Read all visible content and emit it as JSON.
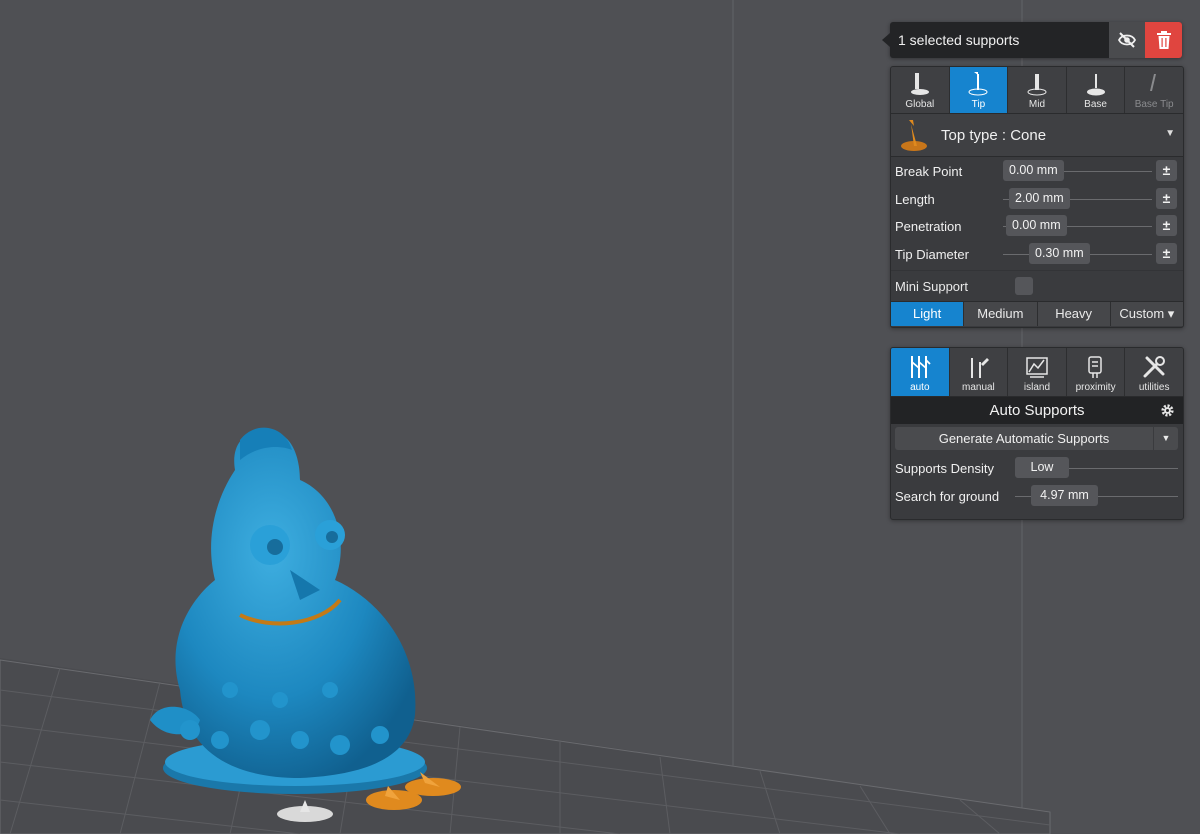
{
  "selection_bar": {
    "text": "1 selected supports",
    "hide_icon": "eye-slash-icon",
    "delete_icon": "trash-icon"
  },
  "support_tabs": [
    {
      "label": "Global",
      "icon": "support-global-icon",
      "active": false,
      "disabled": false
    },
    {
      "label": "Tip",
      "icon": "support-tip-icon",
      "active": true,
      "disabled": false
    },
    {
      "label": "Mid",
      "icon": "support-mid-icon",
      "active": false,
      "disabled": false
    },
    {
      "label": "Base",
      "icon": "support-base-icon",
      "active": false,
      "disabled": false
    },
    {
      "label": "Base Tip",
      "icon": "support-base-tip-icon",
      "active": false,
      "disabled": true
    }
  ],
  "top_type": {
    "label": "Top type : Cone",
    "icon": "cone-support-icon"
  },
  "params": [
    {
      "label": "Break Point",
      "value": "0.00 mm"
    },
    {
      "label": "Length",
      "value": "2.00 mm"
    },
    {
      "label": "Penetration",
      "value": "0.00 mm"
    },
    {
      "label": "Tip Diameter",
      "value": "0.30 mm"
    }
  ],
  "pm_label": "±",
  "mini_support": {
    "label": "Mini Support",
    "checked": false
  },
  "density_presets": [
    {
      "label": "Light",
      "active": true
    },
    {
      "label": "Medium",
      "active": false
    },
    {
      "label": "Heavy",
      "active": false
    },
    {
      "label": "Custom ▾",
      "active": false
    }
  ],
  "mode_tabs": [
    {
      "label": "auto",
      "icon": "auto-supports-icon",
      "active": true
    },
    {
      "label": "manual",
      "icon": "manual-supports-icon",
      "active": false
    },
    {
      "label": "island",
      "icon": "island-icon",
      "active": false
    },
    {
      "label": "proximity",
      "icon": "proximity-icon",
      "active": false
    },
    {
      "label": "utilities",
      "icon": "tools-icon",
      "active": false
    }
  ],
  "auto_supports": {
    "title": "Auto Supports",
    "generate_label": "Generate Automatic Supports",
    "density_label": "Supports Density",
    "density_value": "Low",
    "search_label": "Search for ground",
    "search_value": "4.97 mm"
  },
  "colors": {
    "accent": "#1684cf",
    "model": "#1f8fc7",
    "support": "#e08a1e",
    "delete": "#e0453f",
    "background": "#4f5054"
  }
}
